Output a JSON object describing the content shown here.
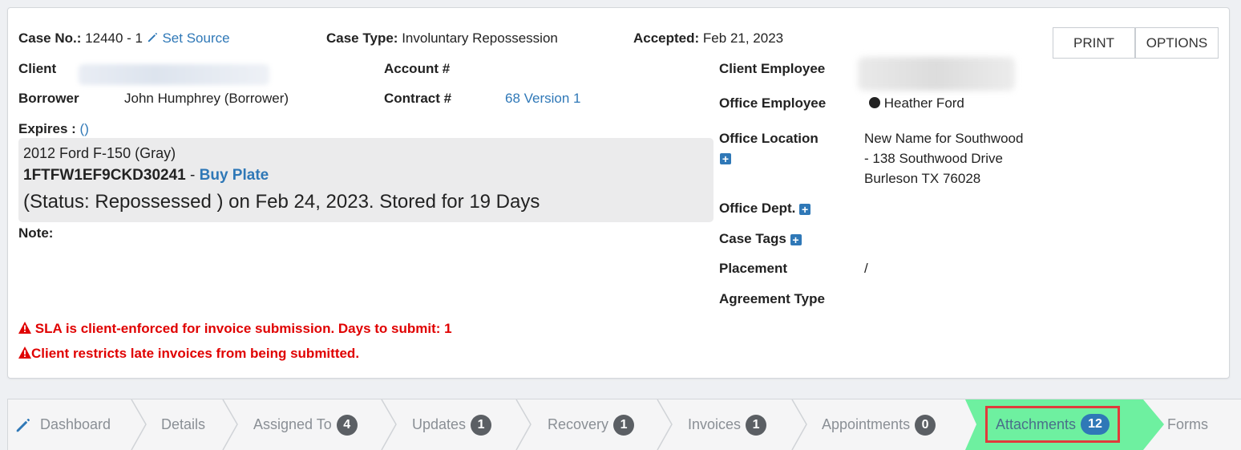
{
  "header": {
    "case_no_label": "Case No.:",
    "case_no_value": "12440 - 1",
    "set_source": "Set Source",
    "case_type_label": "Case Type:",
    "case_type_value": "Involuntary Repossession",
    "accepted_label": "Accepted:",
    "accepted_value": "Feb 21, 2023",
    "print_button": "PRINT",
    "options_button": "OPTIONS"
  },
  "left": {
    "client_label": "Client",
    "borrower_label": "Borrower",
    "borrower_value": "John Humphrey (Borrower)",
    "account_label": "Account #",
    "contract_label": "Contract #",
    "contract_value": "68 Version 1",
    "expires_label": "Expires :",
    "expires_value": "()",
    "vehicle_desc": "2012 Ford F-150 (Gray)",
    "vin": "1FTFW1EF9CKD30241",
    "vin_sep": " - ",
    "buy_plate": "Buy Plate",
    "status_text": "(Status: Repossessed ) on Feb 24, 2023. Stored for 19 Days",
    "note_label": "Note:"
  },
  "right": {
    "client_employee_label": "Client Employee",
    "office_employee_label": "Office Employee",
    "office_employee_value": "Heather Ford",
    "office_location_label": "Office Location",
    "office_location_line1": "New Name for Southwood",
    "office_location_line2": "- 138 Southwood Drive",
    "office_location_line3": "Burleson TX 76028",
    "office_dept_label": "Office Dept.",
    "case_tags_label": "Case Tags",
    "placement_label": "Placement",
    "placement_value": "/",
    "agreement_type_label": "Agreement Type"
  },
  "warnings": {
    "sla": "SLA is client-enforced for invoice submission. Days to submit: 1",
    "late": "Client restricts late invoices from being submitted."
  },
  "tabs": [
    {
      "label": "Dashboard",
      "icon": "pencil-icon"
    },
    {
      "label": "Details"
    },
    {
      "label": "Assigned To",
      "count": "4"
    },
    {
      "label": "Updates",
      "count": "1"
    },
    {
      "label": "Recovery",
      "count": "1"
    },
    {
      "label": "Invoices",
      "count": "1"
    },
    {
      "label": "Appointments",
      "count": "0"
    },
    {
      "label": "Attachments",
      "count": "12",
      "active": true
    },
    {
      "label": "Forms"
    }
  ],
  "colors": {
    "accent": "#2f78b7",
    "warning": "#e00000",
    "active_tab": "#6ef0a0",
    "highlight_border": "#e03b3b"
  }
}
